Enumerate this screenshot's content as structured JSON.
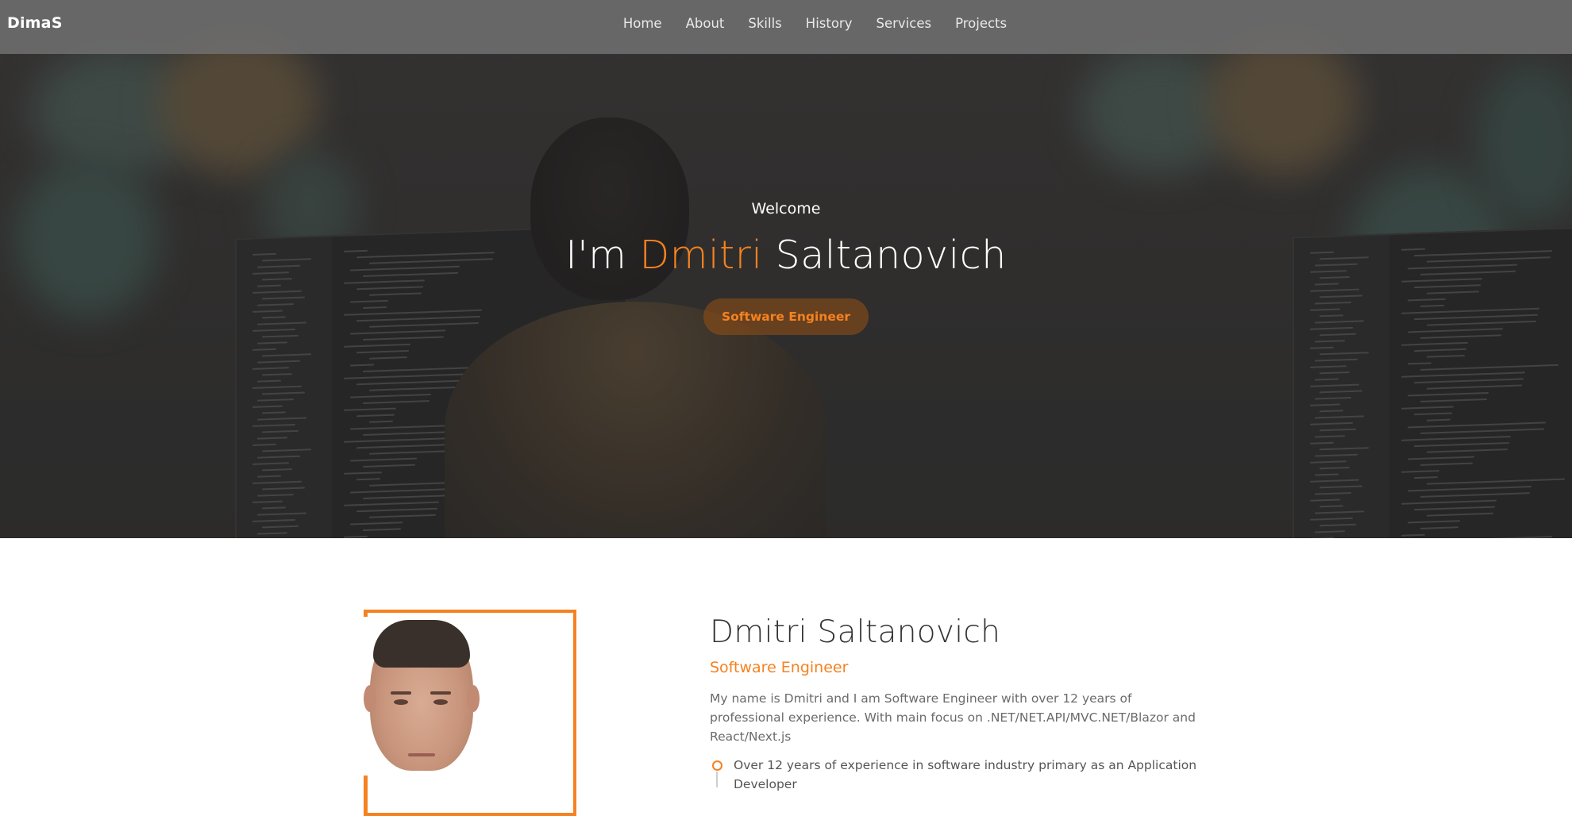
{
  "header": {
    "brand": "DimaS",
    "nav": [
      {
        "label": "Home"
      },
      {
        "label": "About"
      },
      {
        "label": "Skills"
      },
      {
        "label": "History"
      },
      {
        "label": "Services"
      },
      {
        "label": "Projects"
      }
    ]
  },
  "hero": {
    "welcome": "Welcome",
    "title_prefix": "I'm ",
    "title_highlight": "Dmitri",
    "title_suffix": " Saltanovich",
    "badge": "Software Engineer"
  },
  "about": {
    "name": "Dmitri Saltanovich",
    "role": "Software Engineer",
    "description": "My name is Dmitri and I am Software Engineer with over 12 years of professional experience. With main focus on .NET/NET.API/MVC.NET/Blazor and React/Next.js",
    "list": [
      {
        "text": "Over 12 years of experience in software industry primary as an Application Developer"
      }
    ]
  },
  "colors": {
    "accent": "#f58220",
    "navbar": "#6e6e6e",
    "text": "#333333"
  }
}
